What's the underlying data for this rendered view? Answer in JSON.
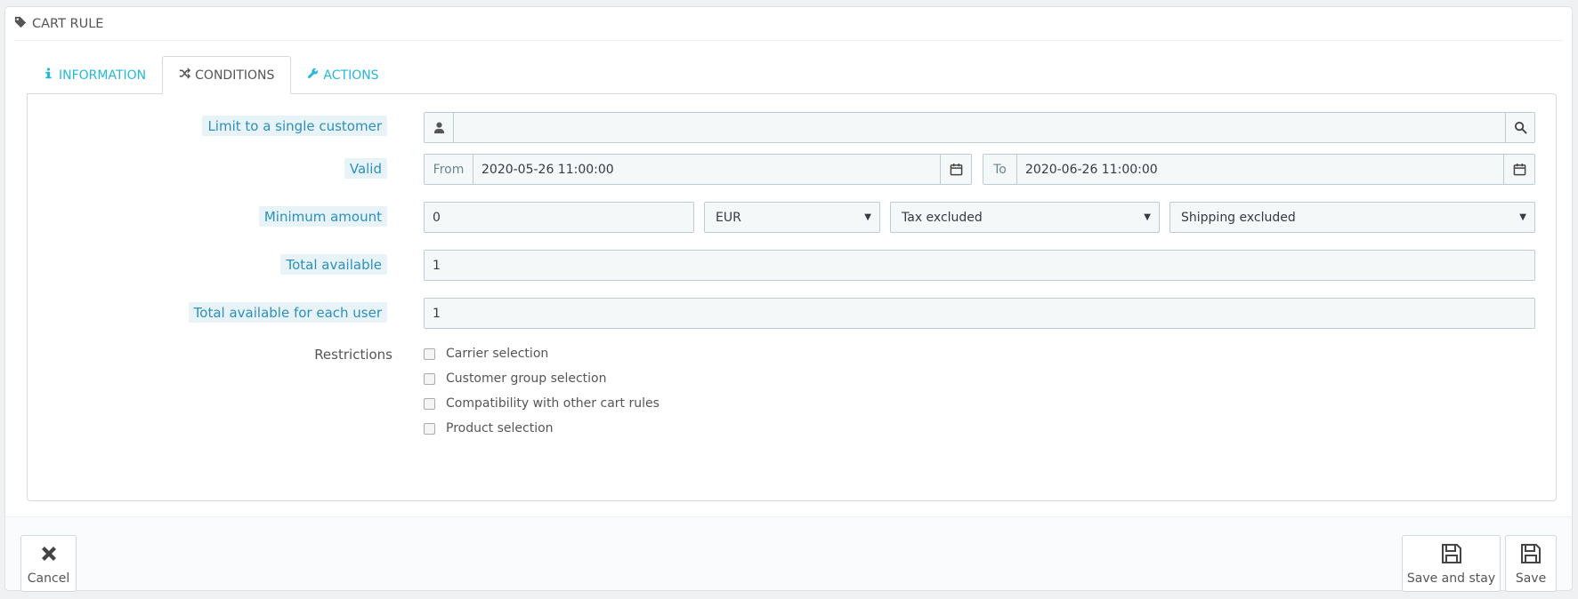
{
  "panel": {
    "title": "CART RULE",
    "title_icon": "tag-icon"
  },
  "tabs": [
    {
      "label": "INFORMATION",
      "icon": "info-icon",
      "active": false
    },
    {
      "label": "CONDITIONS",
      "icon": "shuffle-icon",
      "active": true
    },
    {
      "label": "ACTIONS",
      "icon": "wrench-icon",
      "active": false
    }
  ],
  "form": {
    "customer": {
      "label": "Limit to a single customer",
      "value": "",
      "left_icon": "user-icon",
      "right_icon": "search-icon"
    },
    "valid": {
      "label": "Valid",
      "from_label": "From",
      "from_value": "2020-05-26 11:00:00",
      "to_label": "To",
      "to_value": "2020-06-26 11:00:00",
      "icon": "calendar-icon"
    },
    "minimum_amount": {
      "label": "Minimum amount",
      "value": "0",
      "currency": "EUR",
      "tax": "Tax excluded",
      "shipping": "Shipping excluded"
    },
    "total_available": {
      "label": "Total available",
      "value": "1"
    },
    "total_per_user": {
      "label": "Total available for each user",
      "value": "1"
    },
    "restrictions": {
      "label": "Restrictions",
      "options": [
        "Carrier selection",
        "Customer group selection",
        "Compatibility with other cart rules",
        "Product selection"
      ]
    }
  },
  "footer": {
    "cancel_label": "Cancel",
    "save_stay_label": "Save and stay",
    "save_label": "Save"
  },
  "colors": {
    "accent": "#25b9d7",
    "label_bg": "#e8f3f8",
    "label_text": "#2c8fbe",
    "input_bg": "#f5f8f9"
  }
}
